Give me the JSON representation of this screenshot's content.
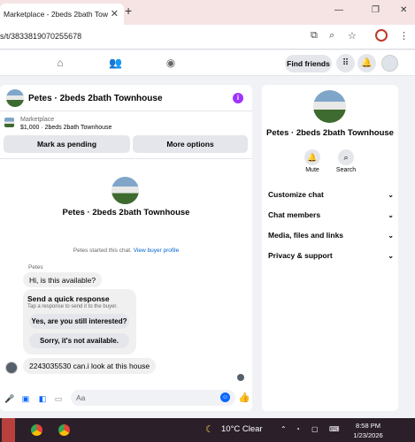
{
  "browser": {
    "tab_title": "Marketplace - 2beds 2bath Tow",
    "url": "s/t/3833819070255678",
    "colors": {
      "tabstrip": "#f6e4e4"
    }
  },
  "fb_nav": {
    "find_friends": "Find friends",
    "icons": [
      "home-icon",
      "friends-icon",
      "groups-icon",
      "menu-grid-icon",
      "notifications-bell-icon",
      "account-avatar"
    ]
  },
  "chat": {
    "header_title": "Petes · 2beds 2bath Townhouse",
    "listing": {
      "category": "Marketplace",
      "price_title": "$1,000 · 2beds 2bath Townhouse",
      "mark_pending": "Mark as pending",
      "more_options": "More options"
    },
    "center_name": "Petes · 2beds 2bath Townhouse",
    "started_text": "Petes started this chat.",
    "view_buyer_profile": "View buyer profile",
    "sender_name": "Petes",
    "message_1": "Hi, is this available?",
    "quick_response": {
      "title": "Send a quick response",
      "subtitle": "Tap a response to send it to the buyer.",
      "option_1": "Yes, are you still interested?",
      "option_2": "Sorry, it's not available."
    },
    "message_2": "2243035530 can.i look at this house",
    "composer_placeholder": "Aa",
    "accent_color": "#0866ff"
  },
  "details": {
    "name": "Petes · 2beds 2bath Townhouse",
    "mute": "Mute",
    "search": "Search",
    "rows": [
      "Customize chat",
      "Chat members",
      "Media, files and links",
      "Privacy & support"
    ]
  },
  "taskbar": {
    "weather": "10°C  Clear",
    "time": "8:58 PM",
    "date": "1/23/2026"
  }
}
